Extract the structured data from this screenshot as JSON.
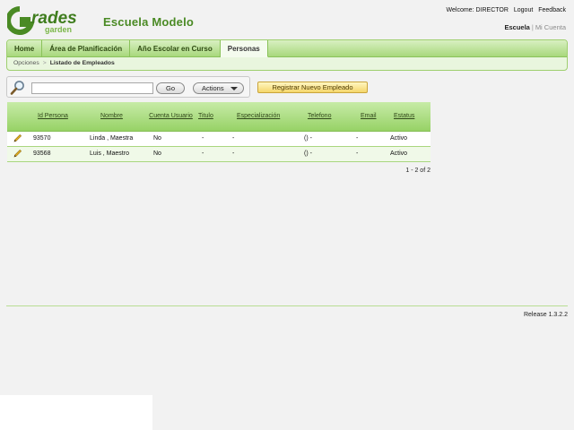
{
  "logo": {
    "top": "rades",
    "bottom": "garden",
    "letter": "G"
  },
  "app_title": "Escuela Modelo",
  "top_links": {
    "welcome_prefix": "Welcome:",
    "user": "DIRECTOR",
    "logout": "Logout",
    "feedback": "Feedback"
  },
  "sub_links": {
    "active": "Escuela",
    "inactive": "Mi Cuenta"
  },
  "tabs": [
    {
      "label": "Home",
      "active": false
    },
    {
      "label": "Área de Planificación",
      "active": false
    },
    {
      "label": "Año Escolar en Curso",
      "active": false
    },
    {
      "label": "Personas",
      "active": true
    }
  ],
  "breadcrumb": {
    "parent": "Opciones",
    "current": "Listado de Empleados"
  },
  "search": {
    "value": "",
    "placeholder": "",
    "go_label": "Go",
    "actions_label": "Actions"
  },
  "register_button": "Registrar Nuevo Empleado",
  "table": {
    "columns": [
      "",
      "Id Persona",
      "Nombre",
      "Cuenta Usuario",
      "Titulo",
      "Especialización",
      "Telefono",
      "Email",
      "Estatus"
    ],
    "rows": [
      {
        "id": "93570",
        "nombre": "Linda , Maestra",
        "cuenta": "No",
        "titulo": "-",
        "especializacion": "-",
        "telefono": "() -",
        "email": "-",
        "estatus": "Activo"
      },
      {
        "id": "93568",
        "nombre": "Luis , Maestro",
        "cuenta": "No",
        "titulo": "-",
        "especializacion": "-",
        "telefono": "() -",
        "email": "-",
        "estatus": "Activo"
      }
    ],
    "pagination": "1 - 2 of 2"
  },
  "release": "Release 1.3.2.2",
  "colors": {
    "brand_green": "#4a8a24",
    "tab_gradient_light": "#d8f0c2",
    "tab_gradient_dark": "#a8d87c",
    "register_yellow": "#f5d66a"
  },
  "icons": {
    "search": "magnifier-icon",
    "edit": "pencil-icon"
  }
}
